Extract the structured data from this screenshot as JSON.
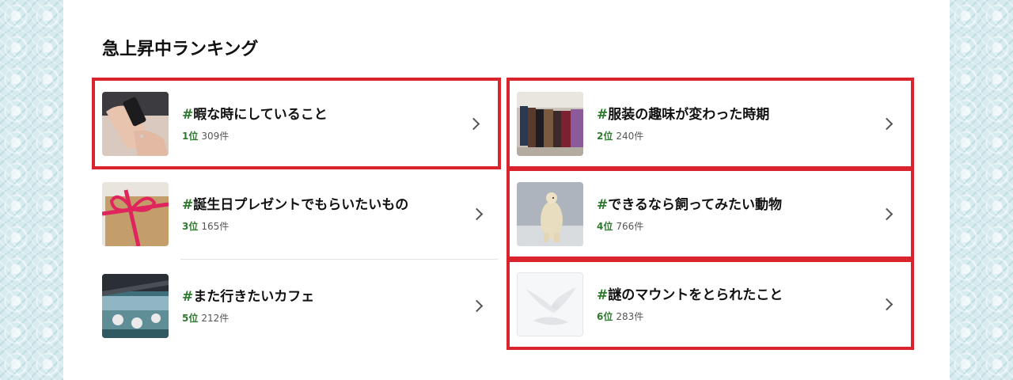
{
  "section": {
    "title": "急上昇中ランキング"
  },
  "items": [
    {
      "hashtag": "#",
      "title": "暇な時にしていること",
      "rank": "1位",
      "count": "309件",
      "icon": "phone-hands-photo"
    },
    {
      "hashtag": "#",
      "title": "服装の趣味が変わった時期",
      "rank": "2位",
      "count": "240件",
      "icon": "clothes-rack-photo"
    },
    {
      "hashtag": "#",
      "title": "誕生日プレゼントでもらいたいもの",
      "rank": "3位",
      "count": "165件",
      "icon": "gift-box-photo"
    },
    {
      "hashtag": "#",
      "title": "できるなら飼ってみたい動物",
      "rank": "4位",
      "count": "766件",
      "icon": "polar-bear-photo"
    },
    {
      "hashtag": "#",
      "title": "また行きたいカフェ",
      "rank": "5位",
      "count": "212件",
      "icon": "cafe-terrace-photo"
    },
    {
      "hashtag": "#",
      "title": "謎のマウントをとられたこと",
      "rank": "6位",
      "count": "283件",
      "icon": "white-birds-photo"
    }
  ],
  "colors": {
    "highlight": "#d9242e",
    "accent": "#2e7a2e"
  }
}
